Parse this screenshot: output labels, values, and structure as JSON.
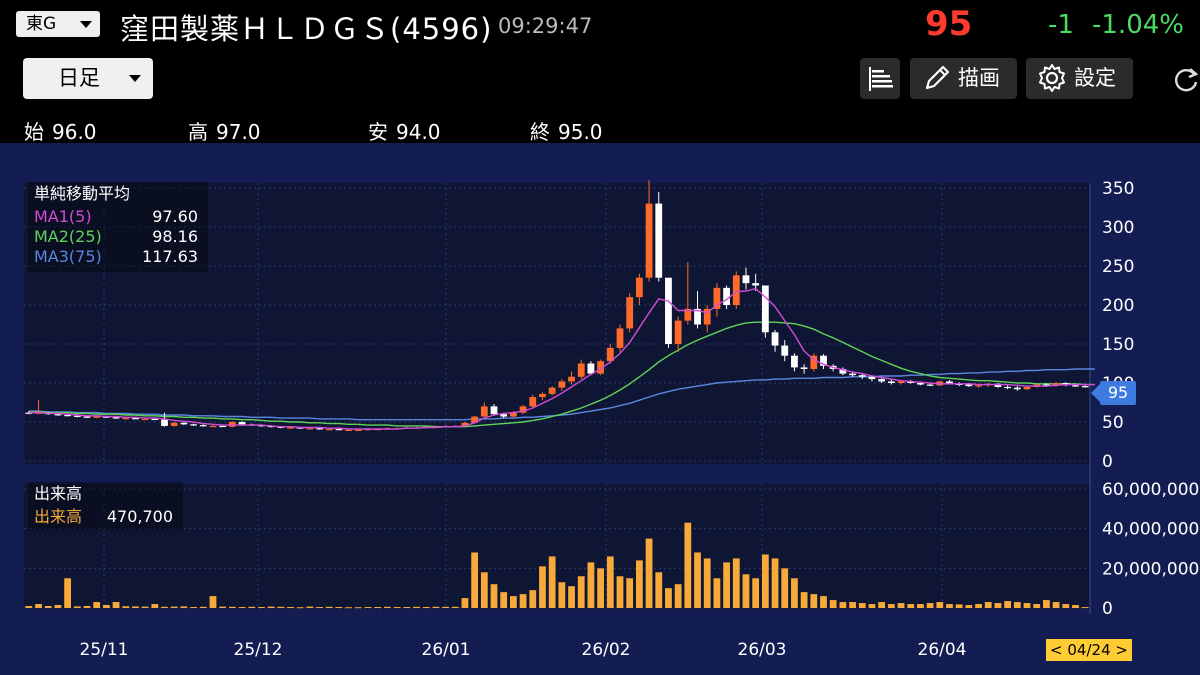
{
  "header": {
    "market": "東G",
    "name": "窪田製薬ＨＬＤＧＳ",
    "code": "(4596)",
    "time": "09:29:47",
    "price": "95",
    "change": "-1",
    "change_pct": "-1.04%"
  },
  "toolbar": {
    "period": "日足",
    "draw_label": "描画",
    "settings_label": "設定"
  },
  "ohlc": {
    "open_label": "始",
    "open": "96.0",
    "high_label": "高",
    "high": "97.0",
    "low_label": "安",
    "low": "94.0",
    "close_label": "終",
    "close": "95.0"
  },
  "ma_legend": {
    "title": "単純移動平均",
    "ma1_label": "MA1(5)",
    "ma1_value": "97.60",
    "ma2_label": "MA2(25)",
    "ma2_value": "98.16",
    "ma3_label": "MA3(75)",
    "ma3_value": "117.63"
  },
  "vol_legend": {
    "title": "出来高",
    "label": "出来高",
    "value": "470,700"
  },
  "price_tag": "95",
  "date_tag": "< 04/24 >",
  "colors": {
    "up": "#ff6a2a",
    "down": "#ffffff",
    "ma1": "#d24bd7",
    "ma2": "#5fd45a",
    "ma3": "#5b86e0",
    "volume": "#f7a93a",
    "background": "#141d52",
    "grid": "#2d3870"
  },
  "chart_data": [
    {
      "type": "candlestick",
      "title": "単純移動平均",
      "yticks": [
        0,
        50,
        100,
        150,
        200,
        250,
        300,
        350
      ],
      "ylim": [
        0,
        350
      ],
      "xticks": [
        "25/11",
        "25/12",
        "26/01",
        "26/02",
        "26/03",
        "26/04"
      ],
      "candles": [
        [
          62,
          64,
          60,
          61
        ],
        [
          61,
          78,
          60,
          62
        ],
        [
          62,
          63,
          59,
          60
        ],
        [
          60,
          61,
          58,
          59
        ],
        [
          59,
          60,
          57,
          58
        ],
        [
          58,
          59,
          56,
          57
        ],
        [
          57,
          58,
          55,
          56
        ],
        [
          56,
          58,
          55,
          57
        ],
        [
          57,
          58,
          55,
          56
        ],
        [
          56,
          57,
          54,
          55
        ],
        [
          55,
          56,
          54,
          55
        ],
        [
          55,
          56,
          54,
          54
        ],
        [
          54,
          55,
          53,
          54
        ],
        [
          54,
          55,
          53,
          53
        ],
        [
          53,
          62,
          44,
          45
        ],
        [
          45,
          50,
          44,
          49
        ],
        [
          49,
          50,
          46,
          47
        ],
        [
          47,
          48,
          45,
          46
        ],
        [
          46,
          47,
          44,
          45
        ],
        [
          45,
          46,
          44,
          45
        ],
        [
          45,
          46,
          44,
          44
        ],
        [
          44,
          51,
          43,
          50
        ],
        [
          50,
          51,
          46,
          47
        ],
        [
          47,
          48,
          45,
          46
        ],
        [
          46,
          47,
          44,
          45
        ],
        [
          45,
          46,
          43,
          44
        ],
        [
          44,
          45,
          42,
          43
        ],
        [
          43,
          44,
          42,
          43
        ],
        [
          43,
          44,
          41,
          42
        ],
        [
          42,
          43,
          41,
          42
        ],
        [
          42,
          43,
          40,
          41
        ],
        [
          41,
          42,
          40,
          41
        ],
        [
          41,
          42,
          40,
          40
        ],
        [
          40,
          41,
          39,
          40
        ],
        [
          40,
          41,
          39,
          40
        ],
        [
          40,
          42,
          39,
          41
        ],
        [
          41,
          42,
          40,
          41
        ],
        [
          41,
          43,
          40,
          42
        ],
        [
          42,
          43,
          41,
          42
        ],
        [
          42,
          44,
          41,
          43
        ],
        [
          43,
          44,
          42,
          43
        ],
        [
          43,
          44,
          42,
          44
        ],
        [
          44,
          45,
          43,
          44
        ],
        [
          44,
          46,
          43,
          45
        ],
        [
          45,
          46,
          44,
          45
        ],
        [
          45,
          50,
          44,
          49
        ],
        [
          49,
          58,
          48,
          57
        ],
        [
          57,
          75,
          55,
          70
        ],
        [
          70,
          73,
          58,
          60
        ],
        [
          60,
          62,
          55,
          57
        ],
        [
          57,
          64,
          56,
          62
        ],
        [
          62,
          72,
          60,
          70
        ],
        [
          70,
          85,
          68,
          82
        ],
        [
          82,
          88,
          78,
          86
        ],
        [
          86,
          96,
          84,
          94
        ],
        [
          94,
          105,
          90,
          102
        ],
        [
          102,
          115,
          98,
          108
        ],
        [
          108,
          130,
          105,
          125
        ],
        [
          125,
          128,
          110,
          112
        ],
        [
          112,
          130,
          110,
          128
        ],
        [
          128,
          150,
          125,
          145
        ],
        [
          145,
          175,
          140,
          170
        ],
        [
          170,
          215,
          165,
          210
        ],
        [
          210,
          240,
          200,
          235
        ],
        [
          235,
          360,
          230,
          330
        ],
        [
          330,
          345,
          230,
          235
        ],
        [
          235,
          190,
          145,
          150
        ],
        [
          150,
          185,
          140,
          180
        ],
        [
          180,
          255,
          175,
          195
        ],
        [
          195,
          218,
          170,
          175
        ],
        [
          175,
          200,
          165,
          195
        ],
        [
          195,
          228,
          185,
          222
        ],
        [
          222,
          225,
          195,
          200
        ],
        [
          200,
          243,
          195,
          238
        ],
        [
          238,
          248,
          220,
          228
        ],
        [
          228,
          240,
          218,
          225
        ],
        [
          225,
          210,
          158,
          165
        ],
        [
          165,
          168,
          140,
          148
        ],
        [
          148,
          155,
          128,
          135
        ],
        [
          135,
          138,
          115,
          120
        ],
        [
          120,
          124,
          112,
          118
        ],
        [
          118,
          138,
          115,
          135
        ],
        [
          135,
          137,
          118,
          122
        ],
        [
          122,
          124,
          115,
          118
        ],
        [
          118,
          120,
          110,
          112
        ],
        [
          112,
          115,
          108,
          110
        ],
        [
          110,
          113,
          105,
          108
        ],
        [
          108,
          110,
          102,
          105
        ],
        [
          105,
          108,
          100,
          102
        ],
        [
          102,
          105,
          98,
          100
        ],
        [
          100,
          104,
          98,
          102
        ],
        [
          102,
          104,
          99,
          100
        ],
        [
          100,
          102,
          97,
          98
        ],
        [
          98,
          100,
          96,
          97
        ],
        [
          97,
          103,
          96,
          102
        ],
        [
          102,
          104,
          98,
          99
        ],
        [
          99,
          101,
          96,
          98
        ],
        [
          98,
          100,
          95,
          96
        ],
        [
          96,
          99,
          94,
          97
        ],
        [
          97,
          100,
          95,
          99
        ],
        [
          99,
          100,
          94,
          95
        ],
        [
          95,
          97,
          92,
          94
        ],
        [
          94,
          96,
          90,
          92
        ],
        [
          92,
          96,
          91,
          95
        ],
        [
          95,
          99,
          94,
          98
        ],
        [
          98,
          100,
          95,
          97
        ],
        [
          97,
          101,
          95,
          100
        ],
        [
          100,
          101,
          96,
          97
        ],
        [
          97,
          98,
          95,
          96
        ],
        [
          96,
          97,
          94,
          95
        ]
      ],
      "ma1": [
        62,
        62,
        61,
        61,
        60,
        59,
        58,
        58,
        57,
        57,
        56,
        56,
        55,
        55,
        54,
        52,
        51,
        50,
        48,
        47,
        46,
        46,
        46,
        46,
        46,
        45,
        44,
        44,
        43,
        43,
        43,
        42,
        42,
        41,
        41,
        41,
        41,
        41,
        41,
        42,
        42,
        43,
        43,
        44,
        44,
        45,
        49,
        55,
        59,
        61,
        62,
        64,
        68,
        74,
        80,
        87,
        95,
        103,
        111,
        118,
        127,
        138,
        152,
        171,
        190,
        208,
        205,
        193,
        193,
        193,
        190,
        200,
        207,
        217,
        218,
        221,
        210,
        198,
        180,
        162,
        141,
        130,
        124,
        120,
        117,
        114,
        112,
        109,
        107,
        105,
        103,
        102,
        101,
        100,
        99,
        99,
        99,
        99,
        98,
        98,
        98,
        98,
        97,
        96,
        96,
        96,
        97,
        98,
        98,
        98,
        98
      ],
      "ma2": [
        63,
        63,
        62,
        62,
        62,
        61,
        61,
        60,
        60,
        60,
        59,
        59,
        58,
        58,
        57,
        57,
        56,
        56,
        55,
        55,
        54,
        54,
        53,
        53,
        52,
        51,
        51,
        50,
        50,
        49,
        49,
        48,
        48,
        47,
        47,
        46,
        46,
        46,
        45,
        45,
        45,
        45,
        44,
        44,
        44,
        44,
        45,
        46,
        47,
        48,
        49,
        50,
        52,
        54,
        57,
        60,
        64,
        68,
        73,
        78,
        84,
        91,
        99,
        108,
        117,
        127,
        135,
        142,
        149,
        155,
        160,
        165,
        170,
        174,
        177,
        178,
        178,
        178,
        177,
        176,
        173,
        169,
        163,
        158,
        152,
        146,
        140,
        134,
        129,
        124,
        119,
        115,
        112,
        109,
        107,
        106,
        105,
        104,
        103,
        103,
        102,
        101,
        100,
        100,
        99,
        99,
        99,
        99,
        99,
        98,
        98
      ],
      "ma3": [
        64,
        64,
        63,
        63,
        63,
        62,
        62,
        62,
        61,
        61,
        61,
        60,
        60,
        60,
        59,
        59,
        59,
        58,
        58,
        58,
        57,
        57,
        57,
        56,
        56,
        56,
        55,
        55,
        55,
        55,
        54,
        54,
        54,
        54,
        53,
        53,
        53,
        53,
        53,
        53,
        53,
        53,
        53,
        53,
        53,
        53,
        54,
        54,
        54,
        55,
        55,
        56,
        56,
        57,
        58,
        59,
        60,
        62,
        64,
        66,
        68,
        71,
        74,
        78,
        82,
        86,
        89,
        92,
        94,
        96,
        98,
        100,
        101,
        102,
        103,
        104,
        104,
        105,
        105,
        106,
        106,
        106,
        107,
        107,
        107,
        108,
        108,
        108,
        109,
        109,
        109,
        110,
        110,
        111,
        111,
        112,
        112,
        113,
        113,
        114,
        114,
        115,
        115,
        116,
        116,
        117,
        117,
        117,
        118,
        118,
        118
      ]
    },
    {
      "type": "bar",
      "title": "出来高",
      "yticks": [
        0,
        20000000,
        40000000,
        60000000
      ],
      "ytick_labels": [
        "0",
        "20,000,000",
        "40,000,000",
        "60,000,000"
      ],
      "ylim": [
        0,
        60000000
      ],
      "values": [
        1000000,
        2000000,
        1000000,
        1500000,
        15000000,
        800000,
        1000000,
        3000000,
        1500000,
        3000000,
        900000,
        800000,
        700000,
        2000000,
        600000,
        700000,
        800000,
        500000,
        600000,
        6000000,
        700000,
        600000,
        500000,
        600000,
        500000,
        700000,
        600000,
        500000,
        400000,
        700000,
        500000,
        600000,
        500000,
        400000,
        400000,
        500000,
        500000,
        600000,
        500000,
        500000,
        600000,
        500000,
        600000,
        600000,
        600000,
        5000000,
        28000000,
        18000000,
        12000000,
        8000000,
        6000000,
        7000000,
        9000000,
        21000000,
        26000000,
        13000000,
        11000000,
        16000000,
        23000000,
        20000000,
        26000000,
        16000000,
        15000000,
        24000000,
        35000000,
        18000000,
        10000000,
        12000000,
        43000000,
        28000000,
        25000000,
        15000000,
        23000000,
        25000000,
        17000000,
        15000000,
        27000000,
        25000000,
        20000000,
        15000000,
        8000000,
        7000000,
        6000000,
        4000000,
        3000000,
        3000000,
        2500000,
        2000000,
        3000000,
        2000000,
        2500000,
        2000000,
        2000000,
        2500000,
        3000000,
        2000000,
        1800000,
        1500000,
        2000000,
        3000000,
        2500000,
        3500000,
        3000000,
        2500000,
        2000000,
        4000000,
        3000000,
        2000000,
        1500000,
        470700
      ]
    }
  ]
}
